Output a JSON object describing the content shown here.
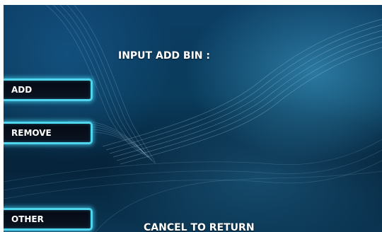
{
  "screen": {
    "title": "INPUT ADD BIN :",
    "footer": "CANCEL TO RETURN"
  },
  "left_keys": [
    {
      "label": "ADD"
    },
    {
      "label": "REMOVE"
    },
    {
      "label": "OTHER"
    }
  ],
  "colors": {
    "background": "#0a3c5c",
    "button_border": "#4fd6ee",
    "button_fill": "#050a14",
    "text": "#ffffff"
  }
}
